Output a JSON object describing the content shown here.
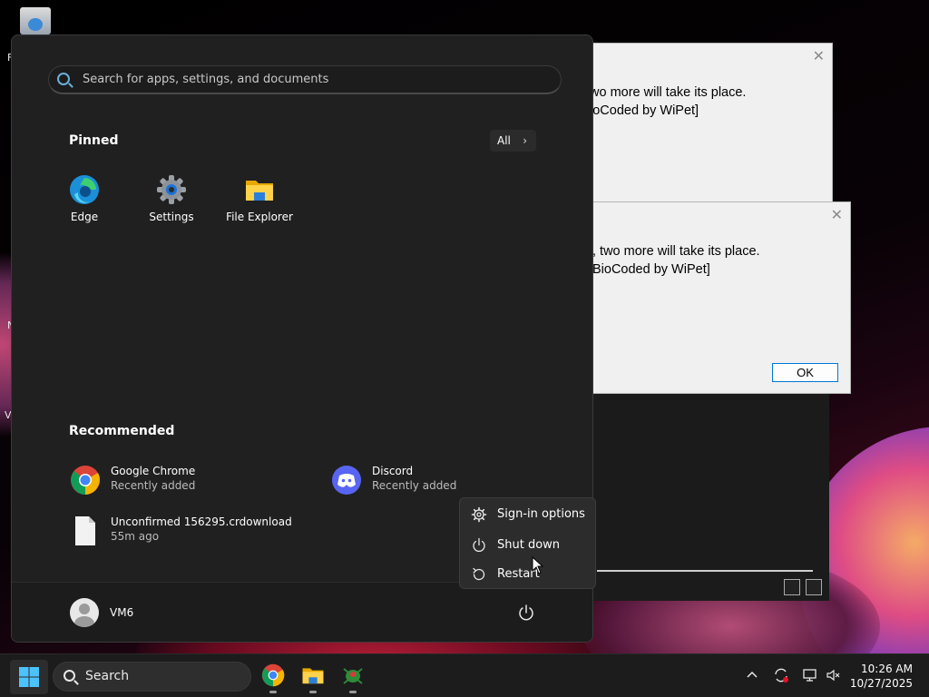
{
  "start_menu": {
    "search_placeholder": "Search for apps, settings, and documents",
    "pinned_title": "Pinned",
    "all_button": "All",
    "pinned": [
      {
        "label": "Edge"
      },
      {
        "label": "Settings"
      },
      {
        "label": "File Explorer"
      }
    ],
    "recommended_title": "Recommended",
    "recommended": [
      {
        "name": "Google Chrome",
        "sub": "Recently added"
      },
      {
        "name": "Discord",
        "sub": "Recently added"
      },
      {
        "name": "Unconfirmed 156295.crdownload",
        "sub": "55m ago"
      }
    ],
    "user_name": "VM6"
  },
  "power_menu": {
    "items": [
      {
        "label": "Sign-in options",
        "icon": "gear-icon"
      },
      {
        "label": "Shut down",
        "icon": "power-icon"
      },
      {
        "label": "Restart",
        "icon": "restart-icon"
      }
    ]
  },
  "dialogs": [
    {
      "line1": "wo more will take its place.",
      "line2": "ioCoded by WiPet]"
    },
    {
      "line1": ", two more will take its place.",
      "line2": "BioCoded by WiPet]",
      "ok_label": "OK"
    }
  ],
  "taskbar": {
    "search_label": "Search",
    "time": "10:26 AM",
    "date": "10/27/2025"
  },
  "colors": {
    "accent": "#0078d7",
    "start_bg": "#202020",
    "dialog_bg": "#f0f0f0"
  }
}
